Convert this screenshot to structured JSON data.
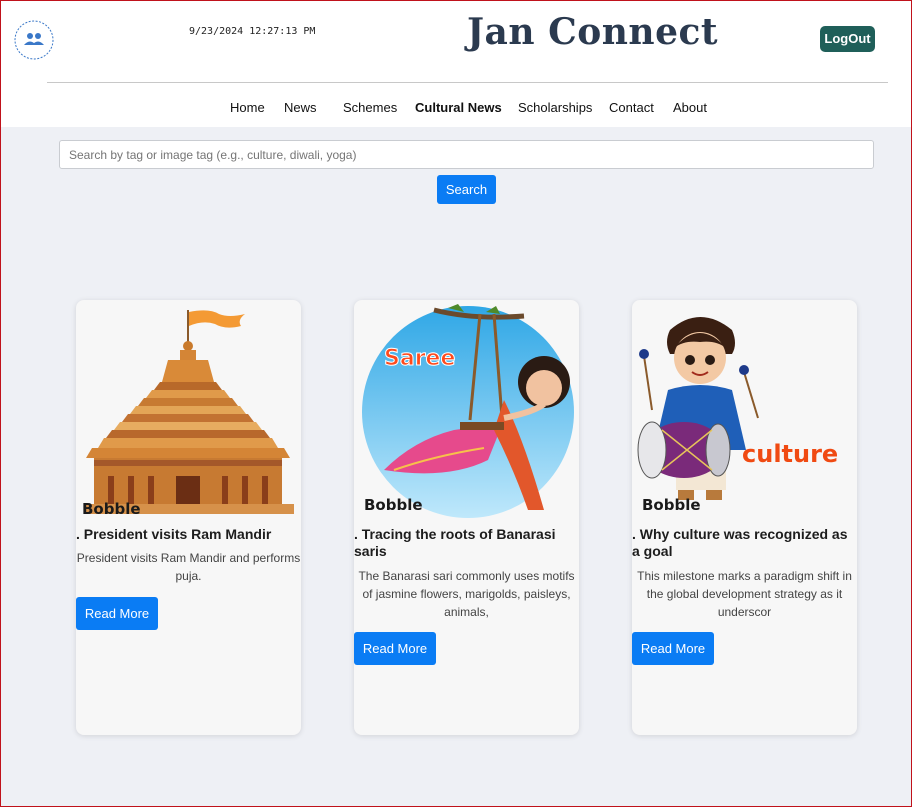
{
  "header": {
    "logo_text": "JAN CONNECT",
    "clock": "9/23/2024 12:27:13 PM",
    "brand": "Jan Connect",
    "logout_label": "LogOut"
  },
  "nav": {
    "items": [
      {
        "label": "Home"
      },
      {
        "label": "News"
      },
      {
        "label": "Schemes"
      },
      {
        "label": "Cultural News",
        "active": true
      },
      {
        "label": "Scholarships"
      },
      {
        "label": "Contact"
      },
      {
        "label": "About"
      }
    ]
  },
  "search": {
    "placeholder": "Search by tag or image tag (e.g., culture, diwali, yoga)",
    "button_label": "Search"
  },
  "cards": [
    {
      "image_icon": "temple-illustration",
      "image_watermark": "Bobble",
      "title": ". President visits Ram Mandir",
      "description": "President visits Ram Mandir and performs puja.",
      "button_label": "Read More"
    },
    {
      "image_icon": "saree-swing-illustration",
      "image_caption": "Saree",
      "image_watermark": "Bobble",
      "title": ". Tracing the roots of Banarasi saris",
      "description": "The Banarasi sari commonly uses motifs of jasmine flowers, marigolds, paisleys, animals,",
      "button_label": "Read More"
    },
    {
      "image_icon": "drummer-boy-illustration",
      "image_caption": "culture",
      "image_watermark": "Bobble",
      "title": ". Why culture was recognized as a goal",
      "description": "This milestone marks a paradigm shift in the global development strategy as it underscor",
      "button_label": "Read More"
    }
  ],
  "colors": {
    "accent": "#0a7cf4",
    "logout": "#1f5f59",
    "brand_text": "#2b3a4f",
    "page_bg": "#eef0f5"
  }
}
